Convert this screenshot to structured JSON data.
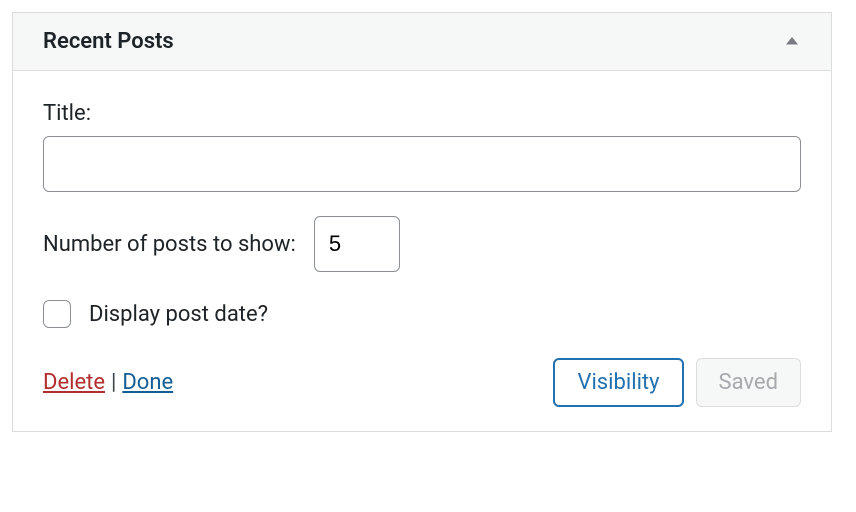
{
  "widget": {
    "title": "Recent Posts",
    "fields": {
      "title_label": "Title:",
      "title_value": "",
      "posts_count_label": "Number of posts to show:",
      "posts_count_value": "5",
      "display_date_label": "Display post date?",
      "display_date_checked": false
    },
    "footer": {
      "delete_label": "Delete",
      "separator": "|",
      "done_label": "Done",
      "visibility_label": "Visibility",
      "saved_label": "Saved"
    }
  }
}
